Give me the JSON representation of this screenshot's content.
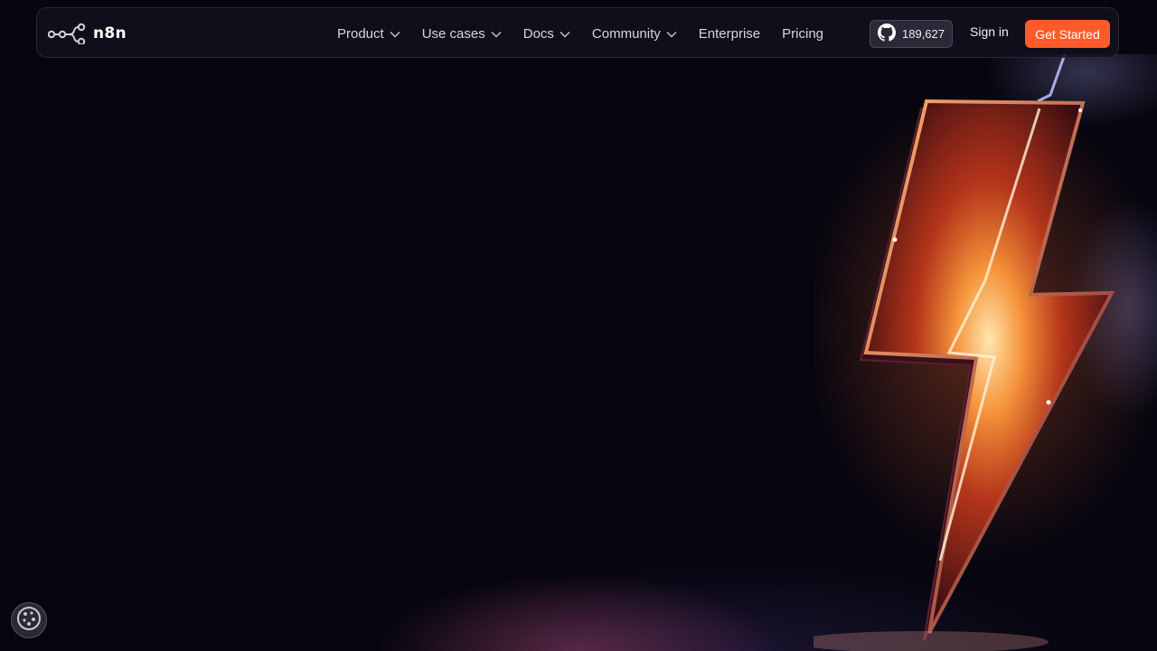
{
  "brand": {
    "name": "n8n",
    "accent_color": "#ff5a28"
  },
  "nav": {
    "items": [
      {
        "label": "Product",
        "has_dropdown": true
      },
      {
        "label": "Use cases",
        "has_dropdown": true
      },
      {
        "label": "Docs",
        "has_dropdown": true
      },
      {
        "label": "Community",
        "has_dropdown": true
      },
      {
        "label": "Enterprise",
        "has_dropdown": false
      },
      {
        "label": "Pricing",
        "has_dropdown": false
      }
    ],
    "github_stars": "189,627",
    "github_icon": "github-icon",
    "signin_label": "Sign in",
    "cta_label": "Get Started"
  },
  "hero": {
    "artwork": "lightning-bolt"
  },
  "cookie": {
    "icon": "cookie-icon"
  }
}
